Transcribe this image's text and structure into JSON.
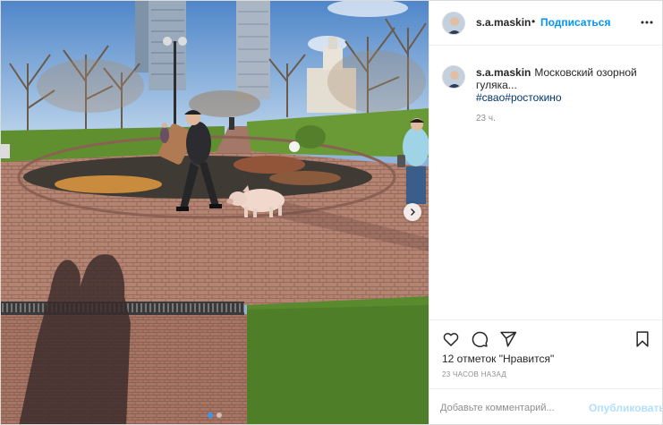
{
  "post": {
    "author": {
      "username": "s.a.maskin",
      "follow_label": "Подписаться",
      "bullet": "•"
    },
    "caption": {
      "username": "s.a.maskin",
      "text": "Московский озорной гуляка...",
      "hashtags": [
        "#свао",
        "#ростокино"
      ],
      "time": "23 ч."
    },
    "likes_text": "12 отметок \"Нравится\"",
    "time_label": "23 ЧАСОВ НАЗАД",
    "comment": {
      "placeholder": "Добавьте комментарий...",
      "publish_label": "Опубликовать"
    }
  },
  "carousel": {
    "current": 1,
    "total": 2
  },
  "icons": {
    "more": "more-options-icon",
    "next": "chevron-right-icon",
    "like": "heart-icon",
    "comment": "comment-icon",
    "share": "send-icon",
    "save": "bookmark-icon"
  },
  "colors": {
    "link": "#0095f6",
    "hashtag": "#00376b",
    "muted": "#8e8e8e",
    "text": "#262626",
    "publish_disabled": "#b2dffc"
  }
}
